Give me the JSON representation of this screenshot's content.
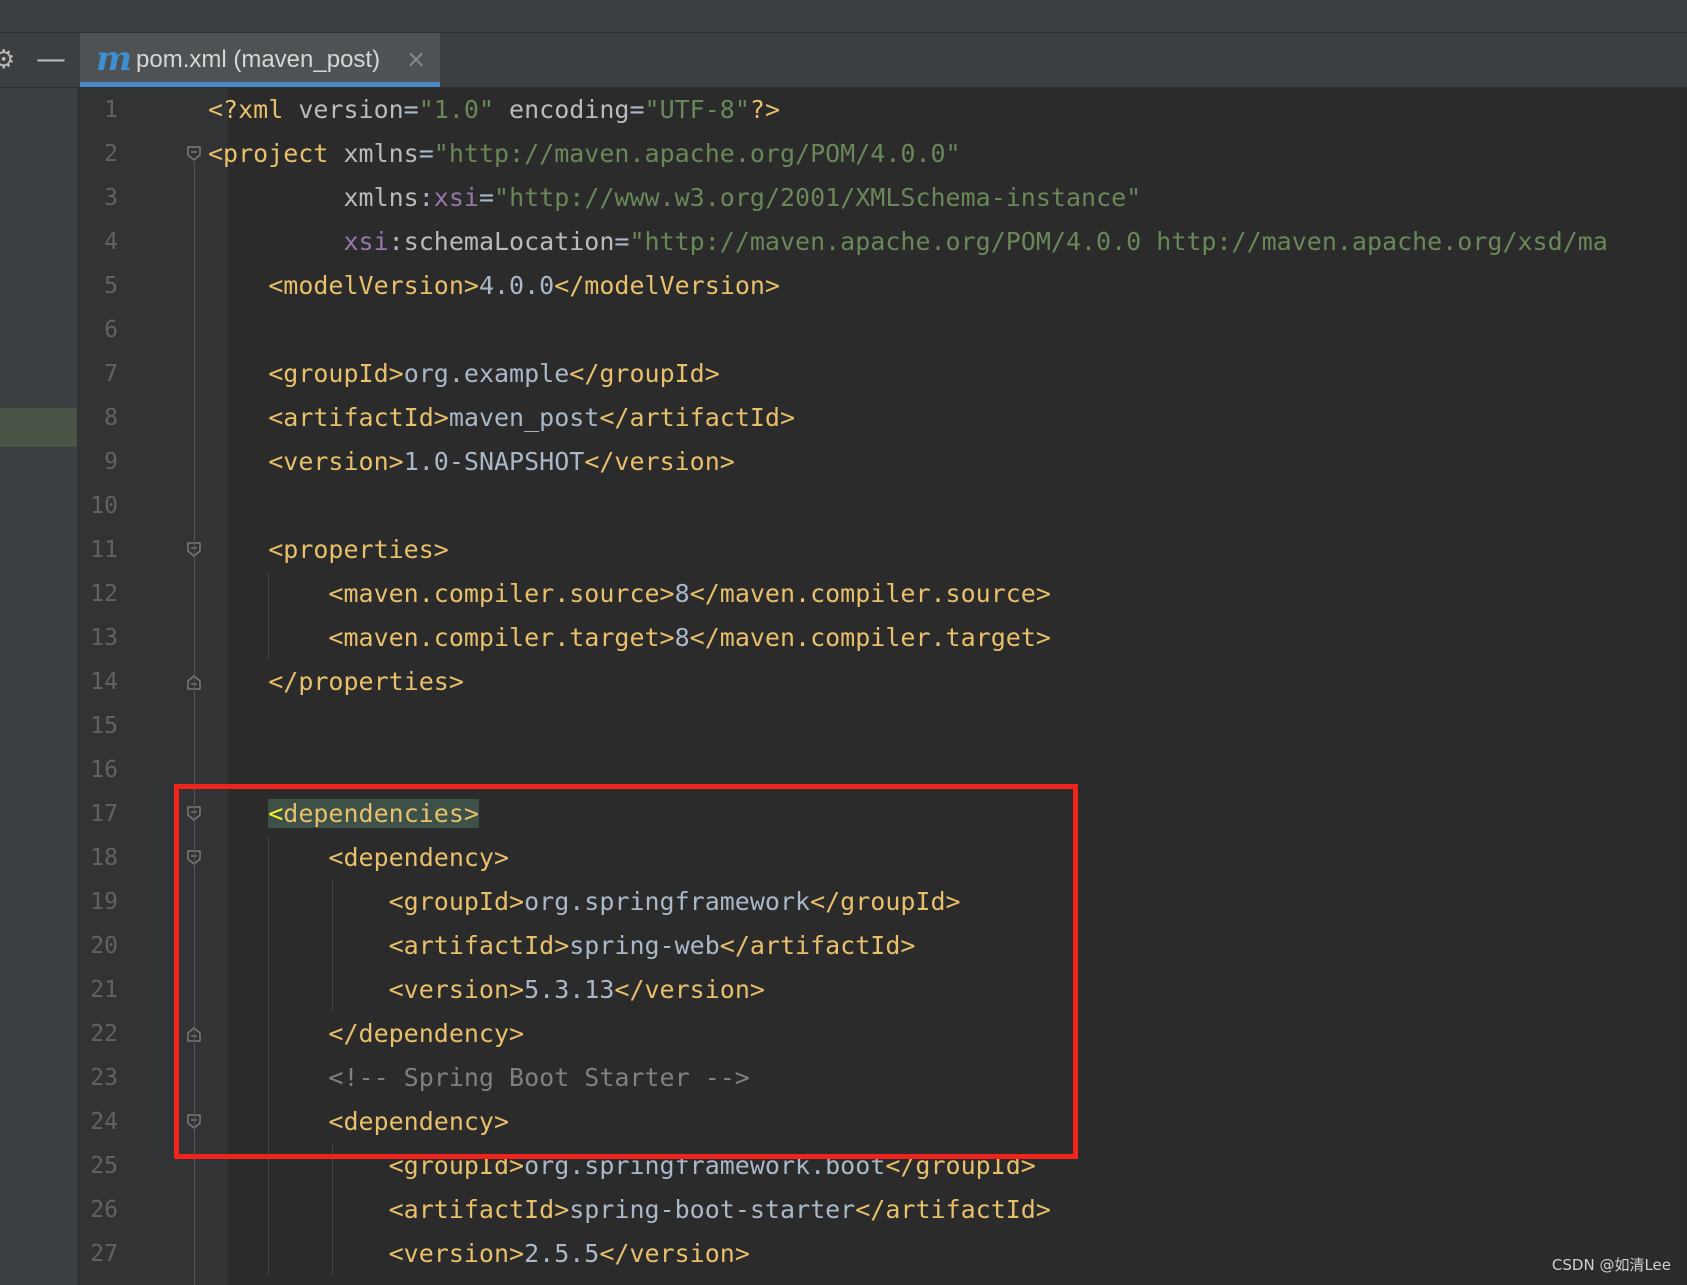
{
  "tab": {
    "icon": "maven-m-icon",
    "label": "pom.xml (maven_post)",
    "close_glyph": "×"
  },
  "toolbar": {
    "settings_icon": "gear-icon",
    "collapse_icon": "minus-icon"
  },
  "lines": [
    {
      "n": "1",
      "tokens": [
        [
          "t",
          "<?xml "
        ],
        [
          "a",
          "version"
        ],
        [
          "x",
          "="
        ],
        [
          "v",
          "\"1.0\""
        ],
        [
          "a",
          " encoding"
        ],
        [
          "x",
          "="
        ],
        [
          "v",
          "\"UTF-8\""
        ],
        [
          "t",
          "?>"
        ]
      ]
    },
    {
      "n": "2",
      "tokens": [
        [
          "t",
          "<project "
        ],
        [
          "a",
          "xmlns"
        ],
        [
          "x",
          "="
        ],
        [
          "v",
          "\"http://maven.apache.org/POM/4.0.0\""
        ]
      ]
    },
    {
      "n": "3",
      "tokens": [
        [
          "x",
          "         "
        ],
        [
          "a",
          "xmlns"
        ],
        [
          "x",
          ":"
        ],
        [
          "p",
          "xsi"
        ],
        [
          "x",
          "="
        ],
        [
          "v",
          "\"http://www.w3.org/2001/XMLSchema-instance\""
        ]
      ]
    },
    {
      "n": "4",
      "tokens": [
        [
          "x",
          "         "
        ],
        [
          "p",
          "xsi"
        ],
        [
          "x",
          ":"
        ],
        [
          "a",
          "schemaLocation"
        ],
        [
          "x",
          "="
        ],
        [
          "v",
          "\"http://maven.apache.org/POM/4.0.0 http://maven.apache.org/xsd/ma"
        ]
      ]
    },
    {
      "n": "5",
      "tokens": [
        [
          "x",
          "    "
        ],
        [
          "t",
          "<modelVersion>"
        ],
        [
          "x",
          "4.0.0"
        ],
        [
          "t",
          "</modelVersion>"
        ]
      ]
    },
    {
      "n": "6",
      "tokens": []
    },
    {
      "n": "7",
      "tokens": [
        [
          "x",
          "    "
        ],
        [
          "t",
          "<groupId>"
        ],
        [
          "x",
          "org.example"
        ],
        [
          "t",
          "</groupId>"
        ]
      ]
    },
    {
      "n": "8",
      "tokens": [
        [
          "x",
          "    "
        ],
        [
          "t",
          "<artifactId>"
        ],
        [
          "x",
          "maven_post"
        ],
        [
          "t",
          "</artifactId>"
        ]
      ]
    },
    {
      "n": "9",
      "tokens": [
        [
          "x",
          "    "
        ],
        [
          "t",
          "<version>"
        ],
        [
          "x",
          "1.0-SNAPSHOT"
        ],
        [
          "t",
          "</version>"
        ]
      ]
    },
    {
      "n": "10",
      "tokens": []
    },
    {
      "n": "11",
      "tokens": [
        [
          "x",
          "    "
        ],
        [
          "t",
          "<properties>"
        ]
      ]
    },
    {
      "n": "12",
      "tokens": [
        [
          "x",
          "        "
        ],
        [
          "t",
          "<maven.compiler.source>"
        ],
        [
          "x",
          "8"
        ],
        [
          "t",
          "</maven.compiler.source>"
        ]
      ]
    },
    {
      "n": "13",
      "tokens": [
        [
          "x",
          "        "
        ],
        [
          "t",
          "<maven.compiler.target>"
        ],
        [
          "x",
          "8"
        ],
        [
          "t",
          "</maven.compiler.target>"
        ]
      ]
    },
    {
      "n": "14",
      "tokens": [
        [
          "x",
          "    "
        ],
        [
          "t",
          "</properties>"
        ]
      ]
    },
    {
      "n": "15",
      "tokens": []
    },
    {
      "n": "16",
      "tokens": []
    },
    {
      "n": "17",
      "tokens": [
        [
          "x",
          "    "
        ],
        [
          "hl",
          "<dependencies>"
        ]
      ]
    },
    {
      "n": "18",
      "tokens": [
        [
          "x",
          "        "
        ],
        [
          "t",
          "<dependency>"
        ]
      ]
    },
    {
      "n": "19",
      "tokens": [
        [
          "x",
          "            "
        ],
        [
          "t",
          "<groupId>"
        ],
        [
          "x",
          "org.springframework"
        ],
        [
          "t",
          "</groupId>"
        ]
      ]
    },
    {
      "n": "20",
      "tokens": [
        [
          "x",
          "            "
        ],
        [
          "t",
          "<artifactId>"
        ],
        [
          "x",
          "spring-web"
        ],
        [
          "t",
          "</artifactId>"
        ]
      ]
    },
    {
      "n": "21",
      "tokens": [
        [
          "x",
          "            "
        ],
        [
          "t",
          "<version>"
        ],
        [
          "x",
          "5.3.13"
        ],
        [
          "t",
          "</version>"
        ]
      ]
    },
    {
      "n": "22",
      "tokens": [
        [
          "x",
          "        "
        ],
        [
          "t",
          "</dependency>"
        ]
      ]
    },
    {
      "n": "23",
      "tokens": [
        [
          "x",
          "        "
        ],
        [
          "c",
          "<!-- Spring Boot Starter -->"
        ]
      ]
    },
    {
      "n": "24",
      "tokens": [
        [
          "x",
          "        "
        ],
        [
          "t",
          "<dependency>"
        ]
      ]
    },
    {
      "n": "25",
      "tokens": [
        [
          "x",
          "            "
        ],
        [
          "t",
          "<groupId>"
        ],
        [
          "x",
          "org.springframework.boot"
        ],
        [
          "t",
          "</groupId>"
        ]
      ]
    },
    {
      "n": "26",
      "tokens": [
        [
          "x",
          "            "
        ],
        [
          "t",
          "<artifactId>"
        ],
        [
          "x",
          "spring-boot-starter"
        ],
        [
          "t",
          "</artifactId>"
        ]
      ]
    },
    {
      "n": "27",
      "tokens": [
        [
          "x",
          "            "
        ],
        [
          "t",
          "<version>"
        ],
        [
          "x",
          "2.5.5"
        ],
        [
          "t",
          "</version>"
        ]
      ]
    }
  ],
  "watermark": "CSDN @如清Lee",
  "colors": {
    "tag": "#e8bf6a",
    "attribute": "#bababa",
    "string": "#6a8759",
    "namespace": "#9876aa",
    "comment": "#808080",
    "text": "#a9b7c6",
    "highlight_box": "#f0241c",
    "tab_underline": "#4a88c7"
  }
}
